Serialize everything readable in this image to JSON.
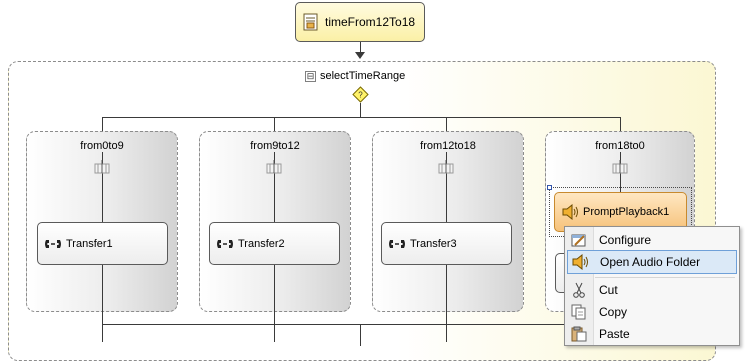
{
  "workflow": {
    "root_activity": {
      "label": "timeFrom12To18",
      "icon": "script-icon"
    },
    "select": {
      "label": "selectTimeRange",
      "collapse_glyph": "⊟",
      "condition_icon": "question-diamond-icon"
    },
    "branches": [
      {
        "label": "from0to9",
        "child": {
          "label": "Transfer1",
          "icon": "transfer-phone-icon"
        }
      },
      {
        "label": "from9to12",
        "child": {
          "label": "Transfer2",
          "icon": "transfer-phone-icon"
        }
      },
      {
        "label": "from12to18",
        "child": {
          "label": "Transfer3",
          "icon": "transfer-phone-icon"
        }
      },
      {
        "label": "from18to0",
        "child": {
          "label": "PromptPlayback1",
          "icon": "speaker-icon"
        }
      }
    ]
  },
  "context_menu": {
    "items": [
      {
        "label": "Configure",
        "icon": "configure-icon",
        "highlighted": false
      },
      {
        "label": "Open Audio Folder",
        "icon": "speaker-icon",
        "highlighted": true
      },
      {
        "label": "Cut",
        "icon": "scissors-icon",
        "highlighted": false
      },
      {
        "label": "Copy",
        "icon": "copy-icon",
        "highlighted": false
      },
      {
        "label": "Paste",
        "icon": "paste-icon",
        "highlighted": false
      }
    ]
  },
  "colors": {
    "root_fill": "#fbf0a6",
    "container_fill": "#fbf7d3",
    "prompt_fill": "#f6c27a",
    "menu_highlight": "#dbe9f7"
  }
}
